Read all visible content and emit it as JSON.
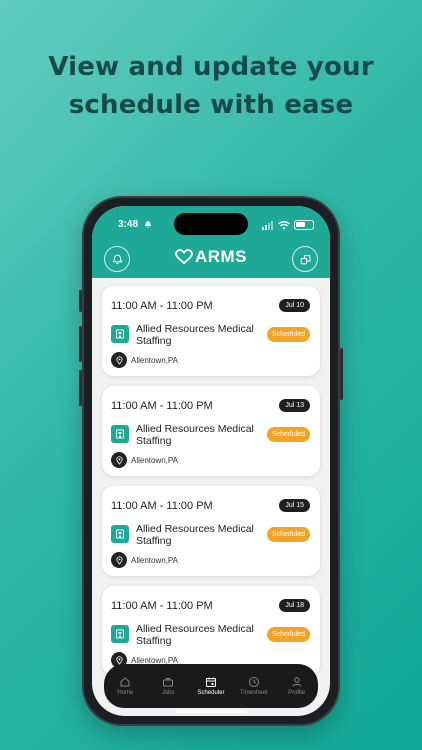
{
  "headline": {
    "line1": "View and update your",
    "line2": "schedule with ease"
  },
  "status_bar": {
    "time": "3:48"
  },
  "app": {
    "logo_text": "ARMS",
    "brand_color": "#1ea896"
  },
  "shifts": [
    {
      "time": "11:00 AM - 11:00 PM",
      "date": "Jul 10",
      "org": "Allied Resources Medical Staffing",
      "status": "Scheduled",
      "location": "Allentown,PA"
    },
    {
      "time": "11:00 AM - 11:00 PM",
      "date": "Jul 13",
      "org": "Allied Resources Medical Staffing",
      "status": "Scheduled",
      "location": "Allentown,PA"
    },
    {
      "time": "11:00 AM - 11:00 PM",
      "date": "Jul 15",
      "org": "Allied Resources Medical Staffing",
      "status": "Scheduled",
      "location": "Allentown,PA"
    },
    {
      "time": "11:00 AM - 11:00 PM",
      "date": "Jul 18",
      "org": "Allied Resources Medical Staffing",
      "status": "Scheduled",
      "location": "Allentown,PA"
    }
  ],
  "tabs": [
    {
      "label": "Home",
      "icon": "home-icon"
    },
    {
      "label": "Jobs",
      "icon": "briefcase-icon"
    },
    {
      "label": "Scheduler",
      "icon": "calendar-icon",
      "active": true
    },
    {
      "label": "Timesheet",
      "icon": "clock-icon"
    },
    {
      "label": "Profile",
      "icon": "person-icon"
    }
  ]
}
